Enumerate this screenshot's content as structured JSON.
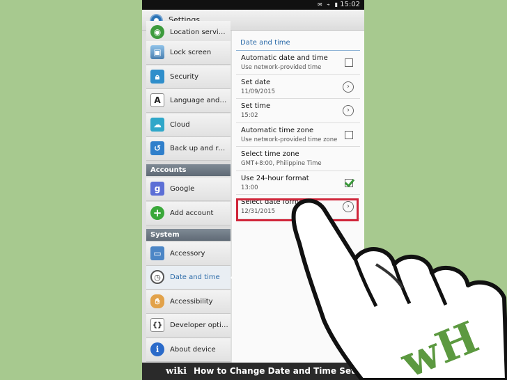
{
  "status_bar": {
    "time": "15:02"
  },
  "title_bar": {
    "title": "Settings"
  },
  "menu": {
    "items_top": [
      {
        "label": "Location servic..."
      },
      {
        "label": "Lock screen"
      },
      {
        "label": "Security"
      },
      {
        "label": "Language and k..."
      },
      {
        "label": "Cloud"
      },
      {
        "label": "Back up and res..."
      }
    ],
    "accounts_header": "Accounts",
    "items_accounts": [
      {
        "label": "Google"
      },
      {
        "label": "Add account"
      }
    ],
    "system_header": "System",
    "items_system": [
      {
        "label": "Accessory"
      },
      {
        "label": "Date and time"
      },
      {
        "label": "Accessibility"
      },
      {
        "label": "Developer optio..."
      },
      {
        "label": "About device"
      }
    ]
  },
  "panel": {
    "section_title": "Date and time",
    "rows": [
      {
        "title": "Automatic date and time",
        "subtitle": "Use network-provided time",
        "control": "checkbox",
        "checked": false
      },
      {
        "title": "Set date",
        "subtitle": "11/09/2015",
        "control": "chevron"
      },
      {
        "title": "Set time",
        "subtitle": "15:02",
        "control": "chevron"
      },
      {
        "title": "Automatic time zone",
        "subtitle": "Use network-provided time zone",
        "control": "checkbox",
        "checked": false
      },
      {
        "title": "Select time zone",
        "subtitle": "GMT+8:00, Philippine Time",
        "control": "none"
      },
      {
        "title": "Use 24-hour format",
        "subtitle": "13:00",
        "control": "checkbox",
        "checked": true
      },
      {
        "title": "Select date format",
        "subtitle": "12/31/2015",
        "control": "chevron"
      }
    ]
  },
  "banner": {
    "logo": "wiki",
    "caption": "How to Change Date and Time Settings on a Samsung Galaxy Device"
  },
  "watermark": "wH",
  "colors": {
    "accent": "#2a6aa8",
    "highlight": "#d0263a",
    "background": "#a7c98f"
  }
}
